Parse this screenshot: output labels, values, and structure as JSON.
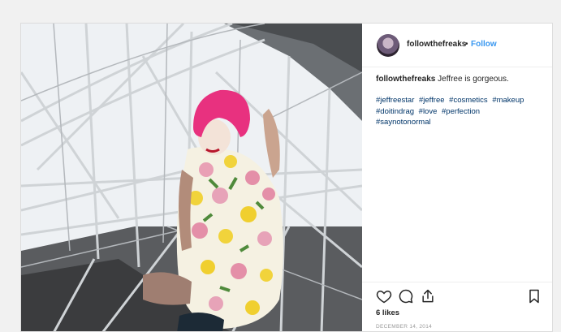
{
  "post": {
    "username": "followthefreaks",
    "separator": "•",
    "follow_label": "Follow",
    "caption": {
      "username": "followthefreaks",
      "text": "Jeffree is gorgeous."
    },
    "hashtags": [
      "#jeffreestar",
      "#jeffree",
      "#cosmetics",
      "#makeup",
      "#doitindrag",
      "#love",
      "#perfection",
      "#saynotonormal"
    ],
    "likes": "6 likes",
    "date": "DECEMBER 14, 2014"
  },
  "icons": {
    "like": "heart-icon",
    "comment": "comment-icon",
    "share": "share-icon",
    "save": "bookmark-icon"
  },
  "colors": {
    "link_blue": "#3897f0",
    "hashtag": "#003569",
    "text": "#262626",
    "muted": "#999999",
    "hair_pink": "#e8317f"
  }
}
